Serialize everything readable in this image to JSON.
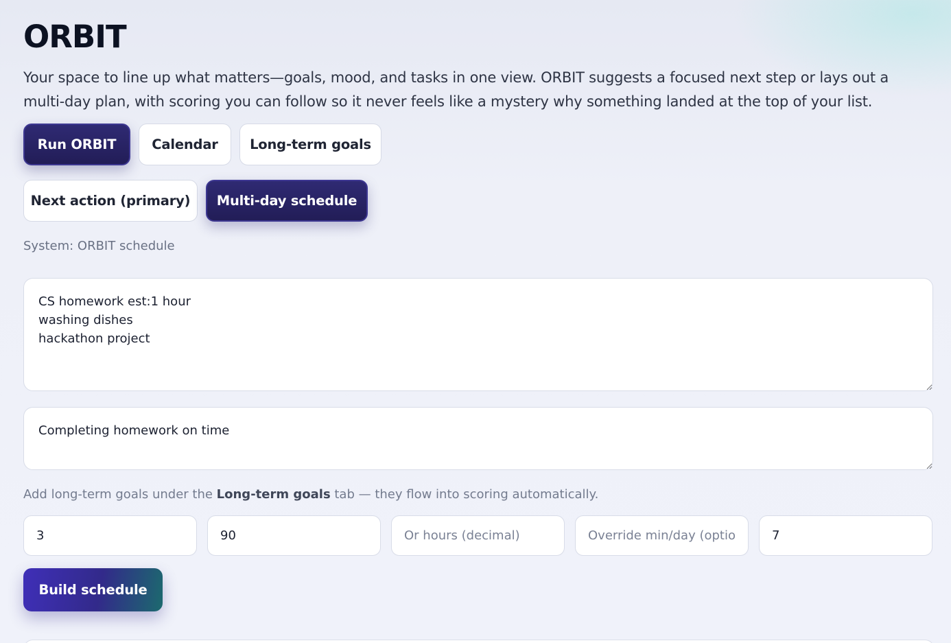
{
  "header": {
    "title": "ORBIT",
    "intro": "Your space to line up what matters—goals, mood, and tasks in one view. ORBIT suggests a focused next step or lays out a multi-day plan, with scoring you can follow so it never feels like a mystery why something landed at the top of your list."
  },
  "main_tabs": [
    {
      "label": "Run ORBIT",
      "active": true
    },
    {
      "label": "Calendar",
      "active": false
    },
    {
      "label": "Long-term goals",
      "active": false
    }
  ],
  "mode_tabs": [
    {
      "label": "Next action (primary)",
      "active": false
    },
    {
      "label": "Multi-day schedule",
      "active": true
    }
  ],
  "system_label": "System: ORBIT schedule",
  "tasks_input": {
    "value": "CS homework est:1 hour\nwashing dishes\nhackathon project"
  },
  "goal_input": {
    "value": "Completing homework on time"
  },
  "hint": {
    "prefix": "Add long-term goals under the ",
    "bold": "Long-term goals",
    "suffix": " tab — they flow into scoring automatically."
  },
  "number_inputs": [
    {
      "value": "3",
      "placeholder": ""
    },
    {
      "value": "90",
      "placeholder": ""
    },
    {
      "value": "",
      "placeholder": "Or hours (decimal)"
    },
    {
      "value": "",
      "placeholder": "Override min/day (optional)"
    },
    {
      "value": "7",
      "placeholder": ""
    }
  ],
  "build_button": {
    "label": "Build schedule"
  },
  "colors": {
    "accent_dark": "#2f2a73",
    "accent_teal": "#1c6a6e",
    "text_primary": "#0c1222",
    "text_muted": "#697184"
  }
}
